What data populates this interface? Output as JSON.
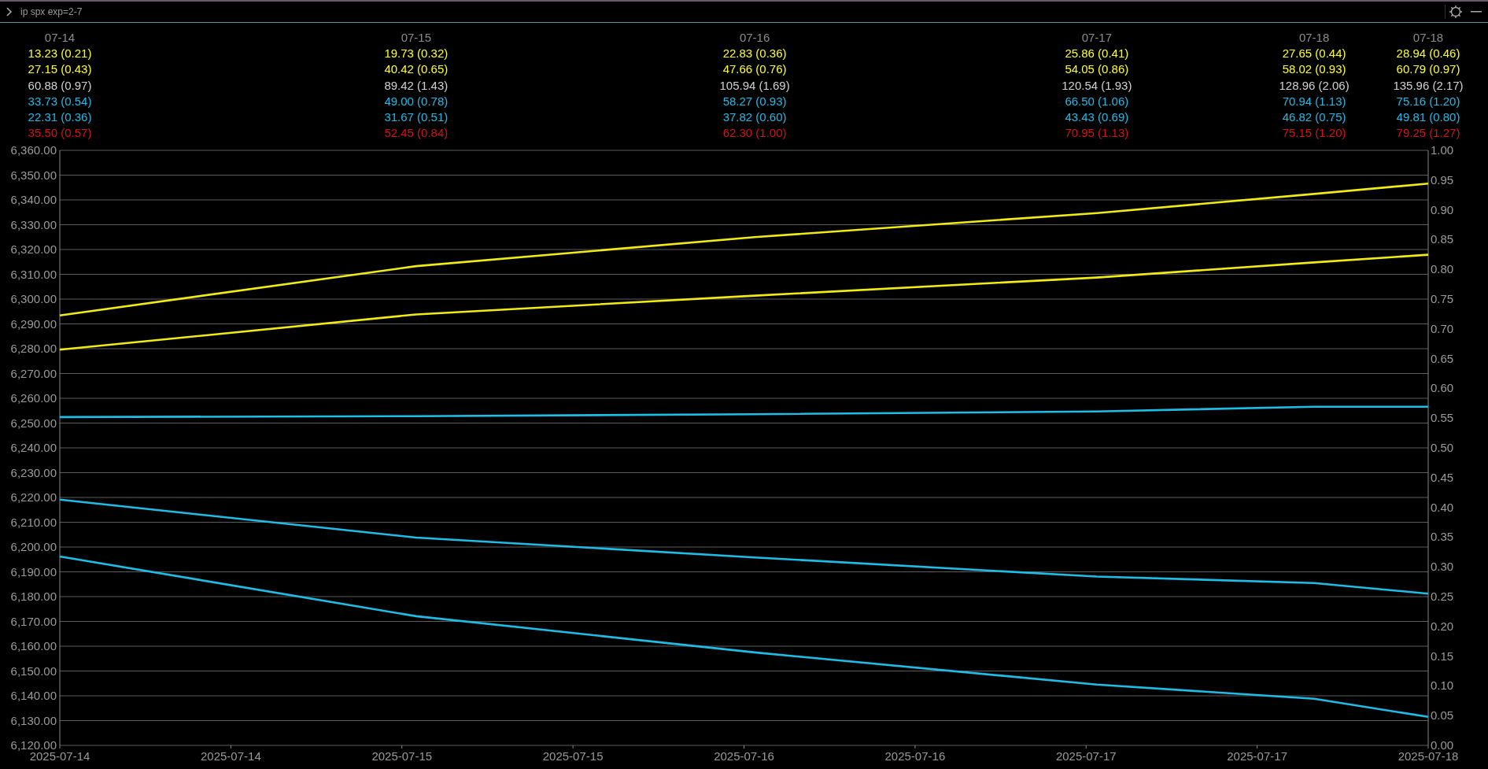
{
  "window": {
    "command": "ip spx exp=2-7"
  },
  "header": {
    "columns": [
      {
        "date": "07-14",
        "rows": [
          {
            "text": "13.23 (0.21)",
            "color": "#ffff1e"
          },
          {
            "text": "27.15 (0.43)",
            "color": "#ffff1e"
          },
          {
            "text": "60.88 (0.97)",
            "color": "#d0d0d0"
          },
          {
            "text": "33.73 (0.54)",
            "color": "#23b9e6"
          },
          {
            "text": "22.31 (0.36)",
            "color": "#23b9e6"
          },
          {
            "text": "35.50 (0.57)",
            "color": "#d01414"
          }
        ]
      },
      {
        "date": "07-15",
        "rows": [
          {
            "text": "19.73 (0.32)",
            "color": "#ffff1e"
          },
          {
            "text": "40.42 (0.65)",
            "color": "#ffff1e"
          },
          {
            "text": "89.42 (1.43)",
            "color": "#d0d0d0"
          },
          {
            "text": "49.00 (0.78)",
            "color": "#23b9e6"
          },
          {
            "text": "31.67 (0.51)",
            "color": "#23b9e6"
          },
          {
            "text": "52.45 (0.84)",
            "color": "#d01414"
          }
        ]
      },
      {
        "date": "07-16",
        "rows": [
          {
            "text": "22.83 (0.36)",
            "color": "#ffff1e"
          },
          {
            "text": "47.66 (0.76)",
            "color": "#ffff1e"
          },
          {
            "text": "105.94 (1.69)",
            "color": "#d0d0d0"
          },
          {
            "text": "58.27 (0.93)",
            "color": "#23b9e6"
          },
          {
            "text": "37.82 (0.60)",
            "color": "#23b9e6"
          },
          {
            "text": "62.30 (1.00)",
            "color": "#d01414"
          }
        ]
      },
      {
        "date": "07-17",
        "rows": [
          {
            "text": "25.86 (0.41)",
            "color": "#ffff1e"
          },
          {
            "text": "54.05 (0.86)",
            "color": "#ffff1e"
          },
          {
            "text": "120.54 (1.93)",
            "color": "#d0d0d0"
          },
          {
            "text": "66.50 (1.06)",
            "color": "#23b9e6"
          },
          {
            "text": "43.43 (0.69)",
            "color": "#23b9e6"
          },
          {
            "text": "70.95 (1.13)",
            "color": "#d01414"
          }
        ]
      },
      {
        "date": "07-18",
        "rows": [
          {
            "text": "27.65 (0.44)",
            "color": "#ffff1e"
          },
          {
            "text": "58.02 (0.93)",
            "color": "#ffff1e"
          },
          {
            "text": "128.96 (2.06)",
            "color": "#d0d0d0"
          },
          {
            "text": "70.94 (1.13)",
            "color": "#23b9e6"
          },
          {
            "text": "46.82 (0.75)",
            "color": "#23b9e6"
          },
          {
            "text": "75.15 (1.20)",
            "color": "#d01414"
          }
        ]
      },
      {
        "date": "07-18",
        "rows": [
          {
            "text": "28.94 (0.46)",
            "color": "#ffff1e"
          },
          {
            "text": "60.79 (0.97)",
            "color": "#ffff1e"
          },
          {
            "text": "135.96 (2.17)",
            "color": "#d0d0d0"
          },
          {
            "text": "75.16 (1.20)",
            "color": "#23b9e6"
          },
          {
            "text": "49.81 (0.80)",
            "color": "#23b9e6"
          },
          {
            "text": "79.25 (1.27)",
            "color": "#d01414"
          }
        ]
      }
    ]
  },
  "chart": {
    "right_axis_ticks": [
      "1.00",
      "0.95",
      "0.90",
      "0.85",
      "0.80",
      "0.75",
      "0.70",
      "0.65",
      "0.60",
      "0.55",
      "0.50",
      "0.45",
      "0.40",
      "0.35",
      "0.30",
      "0.25",
      "0.20",
      "0.15",
      "0.10",
      "0.05",
      "0.00"
    ],
    "chart_data": {
      "type": "line",
      "x": [
        "2025-07-14T00:00",
        "2025-07-15T01:00",
        "2025-07-16T00:45",
        "2025-07-17T00:45",
        "2025-07-17T16:00",
        "2025-07-18T00:00"
      ],
      "series": [
        {
          "color": "#f0eb14",
          "values": [
            6293.4,
            6313.3,
            6325,
            6334.7,
            6342.4,
            6346.6
          ]
        },
        {
          "color": "#f0eb14",
          "values": [
            6279.6,
            6293.8,
            6301.4,
            6308.7,
            6314.8,
            6317.9
          ]
        },
        {
          "color": "#1fbde6",
          "values": [
            6252.4,
            6252.8,
            6253.6,
            6254.7,
            6256.6,
            6256.6
          ]
        },
        {
          "color": "#1fbde6",
          "values": [
            6219.1,
            6203.8,
            6195.8,
            6188.1,
            6185.5,
            6181.2
          ]
        },
        {
          "color": "#1fbde6",
          "values": [
            6196.2,
            6172.1,
            6157.5,
            6144.5,
            6138.8,
            6131.5
          ]
        }
      ],
      "grid": "y",
      "xlim": [
        "2025-07-14T00:00",
        "2025-07-18T00:00"
      ],
      "ylim": [
        6120,
        6360
      ],
      "xticks": [
        {
          "value": "2025-07-14T00:00",
          "label": "2025-07-14"
        },
        {
          "value": "2025-07-14T12:00",
          "label": "2025-07-14"
        },
        {
          "value": "2025-07-15T00:00",
          "label": "2025-07-15"
        },
        {
          "value": "2025-07-15T12:00",
          "label": "2025-07-15"
        },
        {
          "value": "2025-07-16T00:00",
          "label": "2025-07-16"
        },
        {
          "value": "2025-07-16T12:00",
          "label": "2025-07-16"
        },
        {
          "value": "2025-07-17T00:00",
          "label": "2025-07-17"
        },
        {
          "value": "2025-07-17T12:00",
          "label": "2025-07-17"
        },
        {
          "value": "2025-07-18T00:00",
          "label": "2025-07-18"
        }
      ],
      "yticks": [
        {
          "value": 6120,
          "label": "6,120.00"
        },
        {
          "value": 6130,
          "label": "6,130.00"
        },
        {
          "value": 6140,
          "label": "6,140.00"
        },
        {
          "value": 6150,
          "label": "6,150.00"
        },
        {
          "value": 6160,
          "label": "6,160.00"
        },
        {
          "value": 6170,
          "label": "6,170.00"
        },
        {
          "value": 6180,
          "label": "6,180.00"
        },
        {
          "value": 6190,
          "label": "6,190.00"
        },
        {
          "value": 6200,
          "label": "6,200.00"
        },
        {
          "value": 6210,
          "label": "6,210.00"
        },
        {
          "value": 6220,
          "label": "6,220.00"
        },
        {
          "value": 6230,
          "label": "6,230.00"
        },
        {
          "value": 6240,
          "label": "6,240.00"
        },
        {
          "value": 6250,
          "label": "6,250.00"
        },
        {
          "value": 6260,
          "label": "6,260.00"
        },
        {
          "value": 6270,
          "label": "6,270.00"
        },
        {
          "value": 6280,
          "label": "6,280.00"
        },
        {
          "value": 6290,
          "label": "6,290.00"
        },
        {
          "value": 6300,
          "label": "6,300.00"
        },
        {
          "value": 6310,
          "label": "6,310.00"
        },
        {
          "value": 6320,
          "label": "6,320.00"
        },
        {
          "value": 6330,
          "label": "6,330.00"
        },
        {
          "value": 6340,
          "label": "6,340.00"
        },
        {
          "value": 6350,
          "label": "6,350.00"
        },
        {
          "value": 6360,
          "label": "6,360.00"
        }
      ]
    }
  }
}
